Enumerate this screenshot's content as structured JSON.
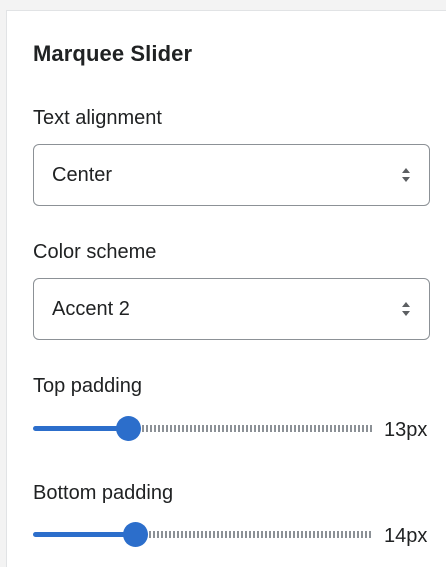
{
  "section": {
    "title": "Marquee Slider"
  },
  "text_alignment": {
    "label": "Text alignment",
    "value": "Center"
  },
  "color_scheme": {
    "label": "Color scheme",
    "value": "Accent 2"
  },
  "top_padding": {
    "label": "Top padding",
    "value_text": "13px",
    "fraction": 0.28
  },
  "bottom_padding": {
    "label": "Bottom padding",
    "value_text": "14px",
    "fraction": 0.3
  },
  "colors": {
    "accent": "#2c6ecb",
    "border": "#8c9196",
    "text": "#202223"
  },
  "icons": {
    "select_chevron": "select-chevron-icon"
  }
}
